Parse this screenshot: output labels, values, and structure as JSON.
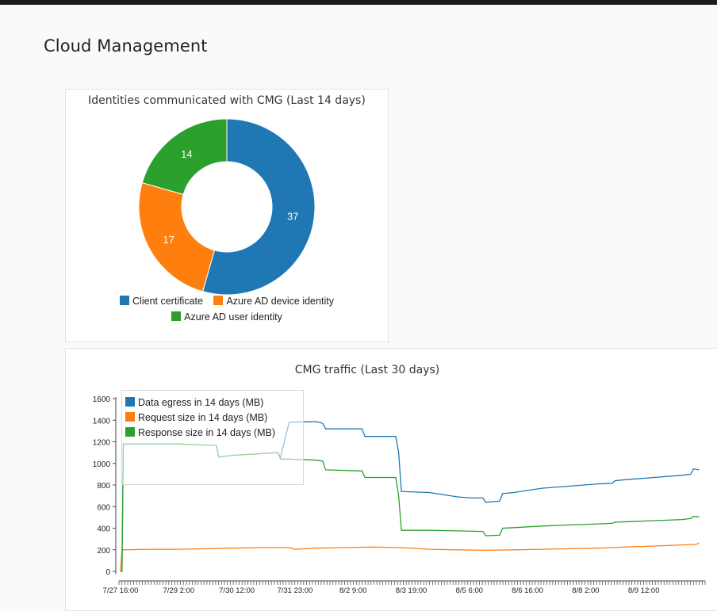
{
  "page": {
    "title": "Cloud Management"
  },
  "colors": {
    "blue": "#1f77b4",
    "orange": "#ff7f0e",
    "green": "#2ca02c"
  },
  "donut": {
    "title": "Identities communicated with CMG (Last 14 days)",
    "slices": [
      {
        "label": "Client certificate",
        "value": 37,
        "color": "#1f77b4"
      },
      {
        "label": "Azure AD device identity",
        "value": 17,
        "color": "#ff7f0e"
      },
      {
        "label": "Azure AD user identity",
        "value": 14,
        "color": "#2ca02c"
      }
    ],
    "value_labels": [
      "37",
      "17",
      "14"
    ]
  },
  "chart_data": [
    {
      "type": "pie",
      "title": "Identities communicated with CMG (Last 14 days)",
      "categories": [
        "Client certificate",
        "Azure AD device identity",
        "Azure AD user identity"
      ],
      "values": [
        37,
        17,
        14
      ],
      "colors": [
        "#1f77b4",
        "#ff7f0e",
        "#2ca02c"
      ],
      "legend": "bottom"
    },
    {
      "type": "line",
      "title": "CMG traffic (Last 30 days)",
      "ylim": [
        0,
        1600
      ],
      "y_ticks": [
        "0",
        "200",
        "400",
        "600",
        "800",
        "1000",
        "1200",
        "1400",
        "1600"
      ],
      "x_ticks": [
        "7/27 16:00",
        "7/29 2:00",
        "7/30 12:00",
        "7/31 23:00",
        "8/2 9:00",
        "8/3 19:00",
        "8/5 6:00",
        "8/6 16:00",
        "8/8 2:00",
        "8/9 12:00"
      ],
      "x_range_days": 15,
      "legend": "top-left",
      "series": [
        {
          "name": "Data egress in 14 days (MB)",
          "color": "#1f77b4",
          "points": [
            [
              0,
              0
            ],
            [
              0.05,
              0
            ],
            [
              0.1,
              1180
            ],
            [
              1,
              1180
            ],
            [
              2,
              1180
            ],
            [
              3,
              1170
            ],
            [
              3.4,
              1170
            ],
            [
              3.5,
              1060
            ],
            [
              4,
              1075
            ],
            [
              5,
              1090
            ],
            [
              5.6,
              1100
            ],
            [
              5.7,
              1060
            ],
            [
              6,
              1380
            ],
            [
              6.5,
              1385
            ],
            [
              7,
              1385
            ],
            [
              7.2,
              1370
            ],
            [
              7.3,
              1320
            ],
            [
              8,
              1320
            ],
            [
              8.6,
              1320
            ],
            [
              8.7,
              1250
            ],
            [
              9.5,
              1250
            ],
            [
              9.8,
              1250
            ],
            [
              9.9,
              1100
            ],
            [
              10,
              740
            ],
            [
              10.5,
              735
            ],
            [
              11,
              730
            ],
            [
              12,
              690
            ],
            [
              12.5,
              680
            ],
            [
              12.9,
              680
            ],
            [
              13,
              640
            ],
            [
              13.5,
              650
            ],
            [
              13.6,
              720
            ],
            [
              14,
              730
            ],
            [
              15,
              770
            ],
            [
              16,
              790
            ],
            [
              17,
              810
            ],
            [
              17.5,
              815
            ],
            [
              17.6,
              840
            ],
            [
              18,
              850
            ],
            [
              19,
              870
            ],
            [
              20,
              890
            ],
            [
              20.3,
              900
            ],
            [
              20.4,
              950
            ],
            [
              20.6,
              940
            ]
          ]
        },
        {
          "name": "Request size in 14 days (MB)",
          "color": "#ff7f0e",
          "points": [
            [
              0,
              0
            ],
            [
              0.05,
              200
            ],
            [
              1,
              205
            ],
            [
              2,
              205
            ],
            [
              3,
              210
            ],
            [
              4,
              215
            ],
            [
              5,
              220
            ],
            [
              6,
              220
            ],
            [
              6.2,
              205
            ],
            [
              7,
              215
            ],
            [
              8,
              220
            ],
            [
              9,
              225
            ],
            [
              10,
              220
            ],
            [
              11,
              205
            ],
            [
              12,
              200
            ],
            [
              13,
              195
            ],
            [
              14,
              200
            ],
            [
              15,
              205
            ],
            [
              16,
              210
            ],
            [
              17,
              215
            ],
            [
              18,
              225
            ],
            [
              19,
              235
            ],
            [
              20,
              245
            ],
            [
              20.5,
              250
            ],
            [
              20.6,
              265
            ]
          ]
        },
        {
          "name": "Response size in 14 days (MB)",
          "color": "#2ca02c",
          "points": [
            [
              0,
              0
            ],
            [
              0.05,
              0
            ],
            [
              0.1,
              1180
            ],
            [
              1,
              1180
            ],
            [
              2,
              1180
            ],
            [
              3,
              1170
            ],
            [
              3.4,
              1170
            ],
            [
              3.5,
              1060
            ],
            [
              4,
              1075
            ],
            [
              5,
              1090
            ],
            [
              5.6,
              1100
            ],
            [
              5.7,
              1040
            ],
            [
              6,
              1040
            ],
            [
              7,
              1030
            ],
            [
              7.2,
              1020
            ],
            [
              7.3,
              940
            ],
            [
              8,
              935
            ],
            [
              8.6,
              930
            ],
            [
              8.7,
              870
            ],
            [
              9.5,
              870
            ],
            [
              9.8,
              870
            ],
            [
              9.9,
              700
            ],
            [
              10,
              380
            ],
            [
              11,
              380
            ],
            [
              12,
              375
            ],
            [
              12.9,
              370
            ],
            [
              13,
              330
            ],
            [
              13.5,
              335
            ],
            [
              13.6,
              400
            ],
            [
              14,
              405
            ],
            [
              15,
              420
            ],
            [
              16,
              430
            ],
            [
              17,
              440
            ],
            [
              17.5,
              445
            ],
            [
              17.6,
              455
            ],
            [
              18,
              460
            ],
            [
              19,
              470
            ],
            [
              20,
              480
            ],
            [
              20.3,
              490
            ],
            [
              20.4,
              510
            ],
            [
              20.6,
              505
            ]
          ]
        }
      ]
    }
  ],
  "traffic": {
    "title": "CMG traffic (Last 30 days)",
    "legend": [
      "Data egress in 14 days (MB)",
      "Request size in 14 days (MB)",
      "Response size in 14 days (MB)"
    ]
  }
}
